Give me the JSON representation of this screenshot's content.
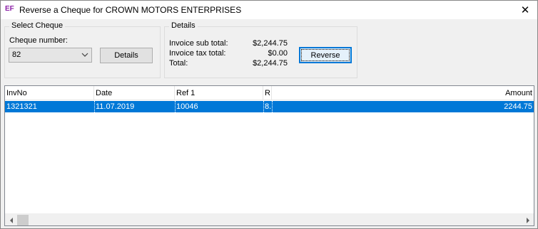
{
  "window": {
    "icon_text": "EF",
    "title": "Reverse a Cheque for CROWN MOTORS ENTERPRISES",
    "close_glyph": "✕"
  },
  "select_cheque": {
    "group_title": "Select Cheque",
    "cheque_label": "Cheque number:",
    "cheque_value": "82",
    "details_button": "Details"
  },
  "details": {
    "group_title": "Details",
    "sub_total_label": "Invoice sub total:",
    "sub_total_value": "$2,244.75",
    "tax_total_label": "Invoice tax total:",
    "tax_total_value": "$0.00",
    "total_label": "Total:",
    "total_value": "$2,244.75",
    "reverse_button": "Reverse"
  },
  "invoice_list": {
    "columns": [
      "InvNo",
      "Date",
      "Ref 1",
      "R",
      "Amount"
    ],
    "rows": [
      {
        "inv_no": "1321321",
        "date": "11.07.2019",
        "ref1": "10046",
        "r": "8.",
        "amount": "2244.75",
        "selected": true
      }
    ]
  },
  "colors": {
    "selection": "#0078d7",
    "app_icon": "#8b1fa6",
    "default_button_border": "#0078d7"
  }
}
